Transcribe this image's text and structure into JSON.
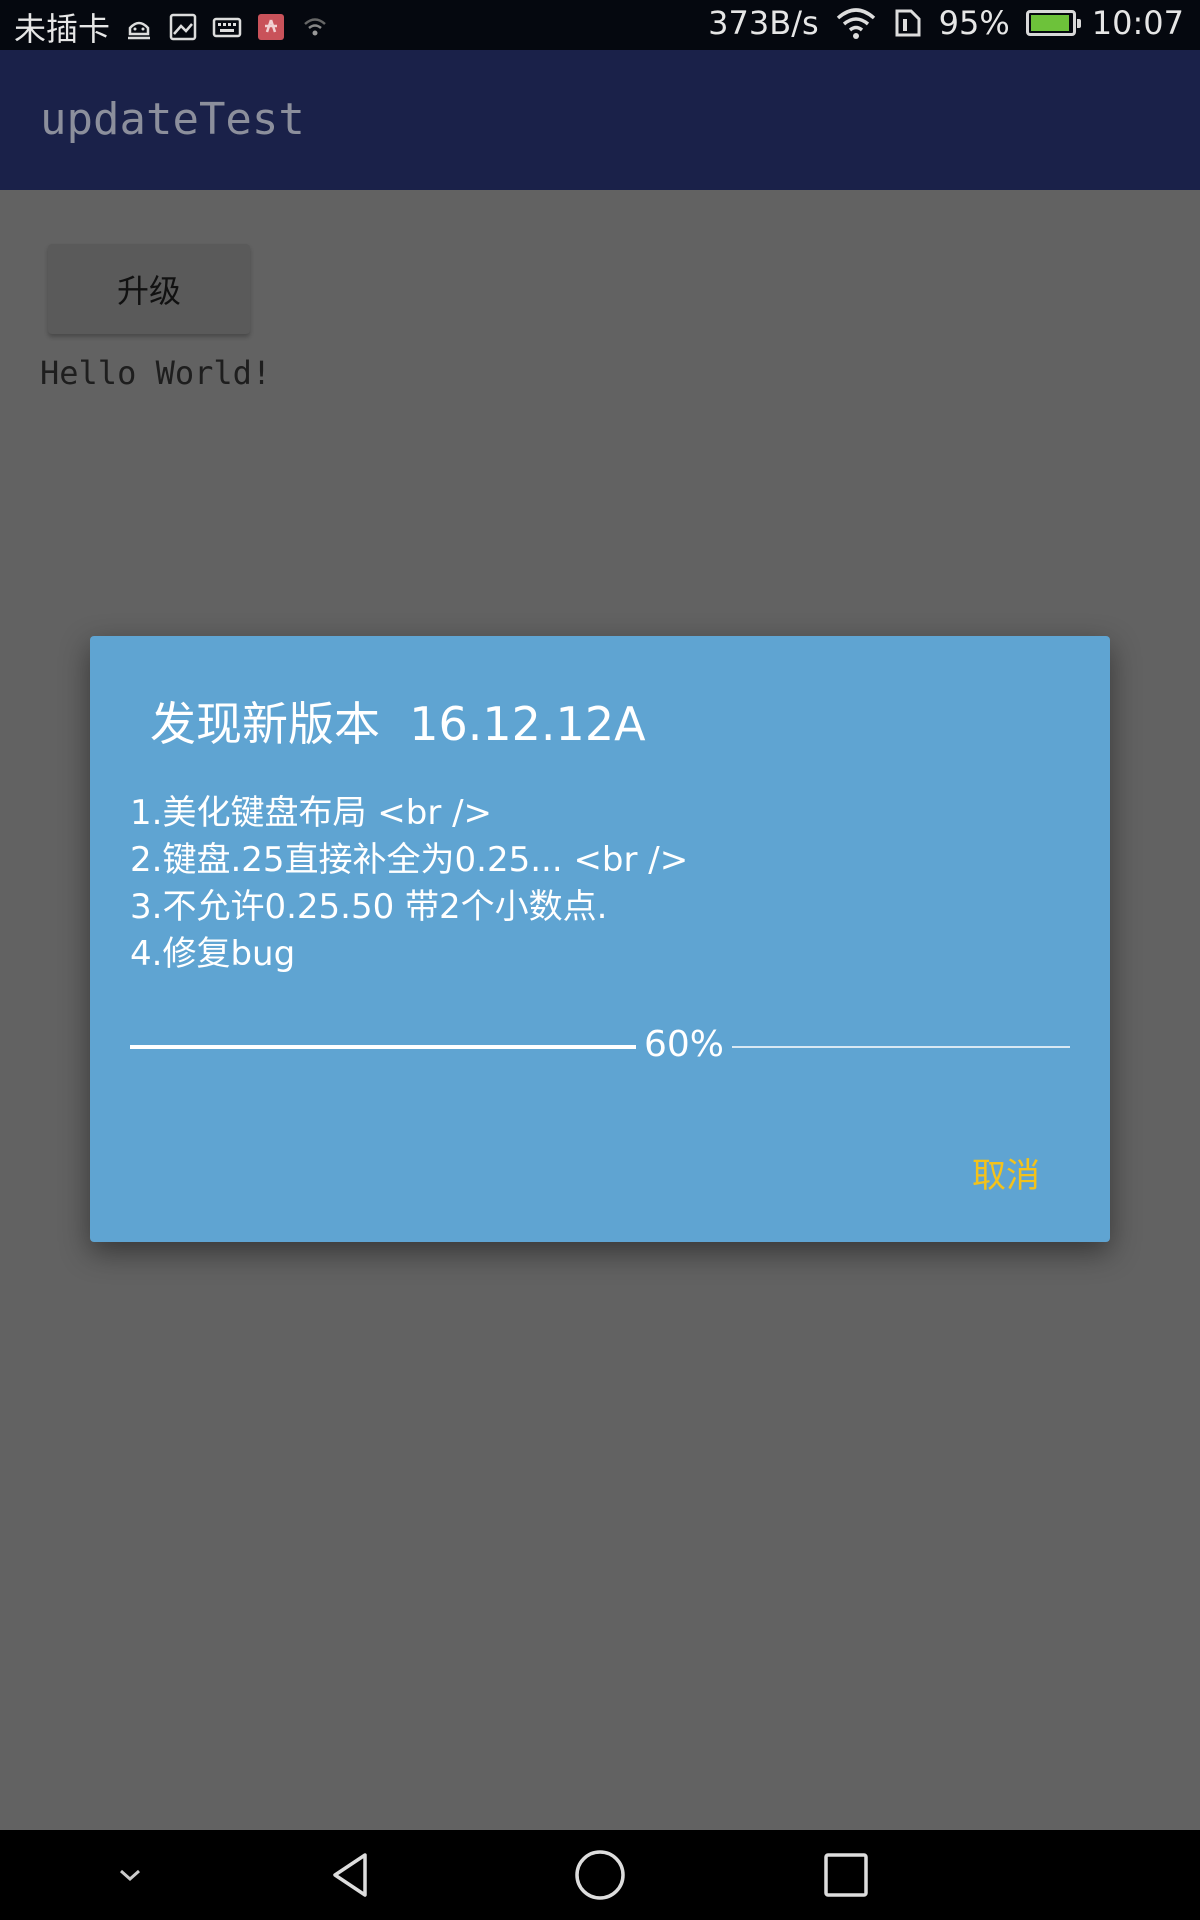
{
  "status_bar": {
    "carrier": "未插卡",
    "net_speed": "373B/s",
    "battery": "95%",
    "battery_level": 0.95,
    "time": "10:07",
    "icons": [
      "android-debug-icon",
      "image-icon",
      "keyboard-icon",
      "huawei-app-icon",
      "wifi-weak-icon",
      "wifi-icon",
      "sim-icon",
      "battery-charging-icon"
    ]
  },
  "app_bar": {
    "title": "updateTest"
  },
  "content": {
    "upgrade_button": "升级",
    "hello_text": "Hello World!"
  },
  "dialog": {
    "title": "发现新版本  16.12.12A",
    "notes": [
      "1.美化键盘布局 <br />",
      "2.键盘.25直接补全为0.25... <br />",
      "3.不允许0.25.50 带2个小数点.",
      "4.修复bug"
    ],
    "progress": {
      "percent": 60,
      "label": "60%"
    },
    "cancel_button": "取消",
    "colors": {
      "background": "#5fa4d2",
      "accent": "#f3c21b"
    }
  },
  "nav_bar": {
    "icons": [
      "chevron-down-icon",
      "back-icon",
      "home-icon",
      "recents-icon"
    ]
  }
}
